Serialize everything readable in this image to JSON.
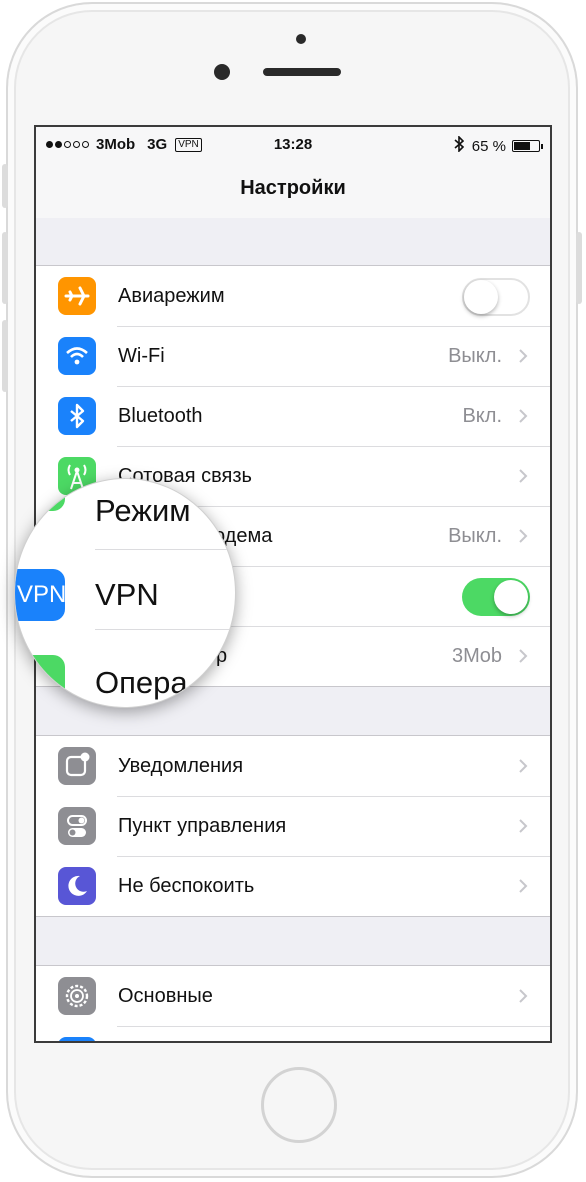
{
  "statusbar": {
    "carrier": "3Mob",
    "network": "3G",
    "vpn_badge": "VPN",
    "time": "13:28",
    "bluetooth": "✱",
    "battery": "65 %",
    "battery_level": 0.65
  },
  "navbar": {
    "title": "Настройки"
  },
  "groups": [
    {
      "rows": [
        {
          "label": "Авиарежим",
          "icon": "airplane-icon",
          "color": "#ff9500",
          "toggle": false
        },
        {
          "label": "Wi-Fi",
          "icon": "wifi-icon",
          "color": "#1a82fb",
          "value": "Выкл."
        },
        {
          "label": "Bluetooth",
          "icon": "bluetooth-icon",
          "color": "#1a82fb",
          "value": "Вкл."
        },
        {
          "label": "Сотовая связь",
          "icon": "cellular-icon",
          "color": "#4cd964"
        },
        {
          "label": "одема",
          "icon": "hotspot-icon",
          "color": "#4cd964",
          "value": "Выкл."
        },
        {
          "label": "",
          "icon": "vpn-icon",
          "color": "#1a82fb",
          "toggle": true
        },
        {
          "label": "р",
          "icon": "carrier-icon",
          "color": "#4cd964",
          "value": "3Mob"
        }
      ]
    },
    {
      "rows": [
        {
          "label": "Уведомления",
          "icon": "notifications-icon",
          "color": "#8e8e93"
        },
        {
          "label": "Пункт управления",
          "icon": "control-center-icon",
          "color": "#8e8e93"
        },
        {
          "label": "Не беспокоить",
          "icon": "moon-icon",
          "color": "#5856d6"
        }
      ]
    },
    {
      "rows": [
        {
          "label": "Основные",
          "icon": "gear-icon",
          "color": "#8e8e93"
        }
      ]
    }
  ],
  "magnifier": {
    "line1": "Режим",
    "vpn_icon_text": "VPN",
    "line2": "VPN",
    "line3": "Опера"
  }
}
